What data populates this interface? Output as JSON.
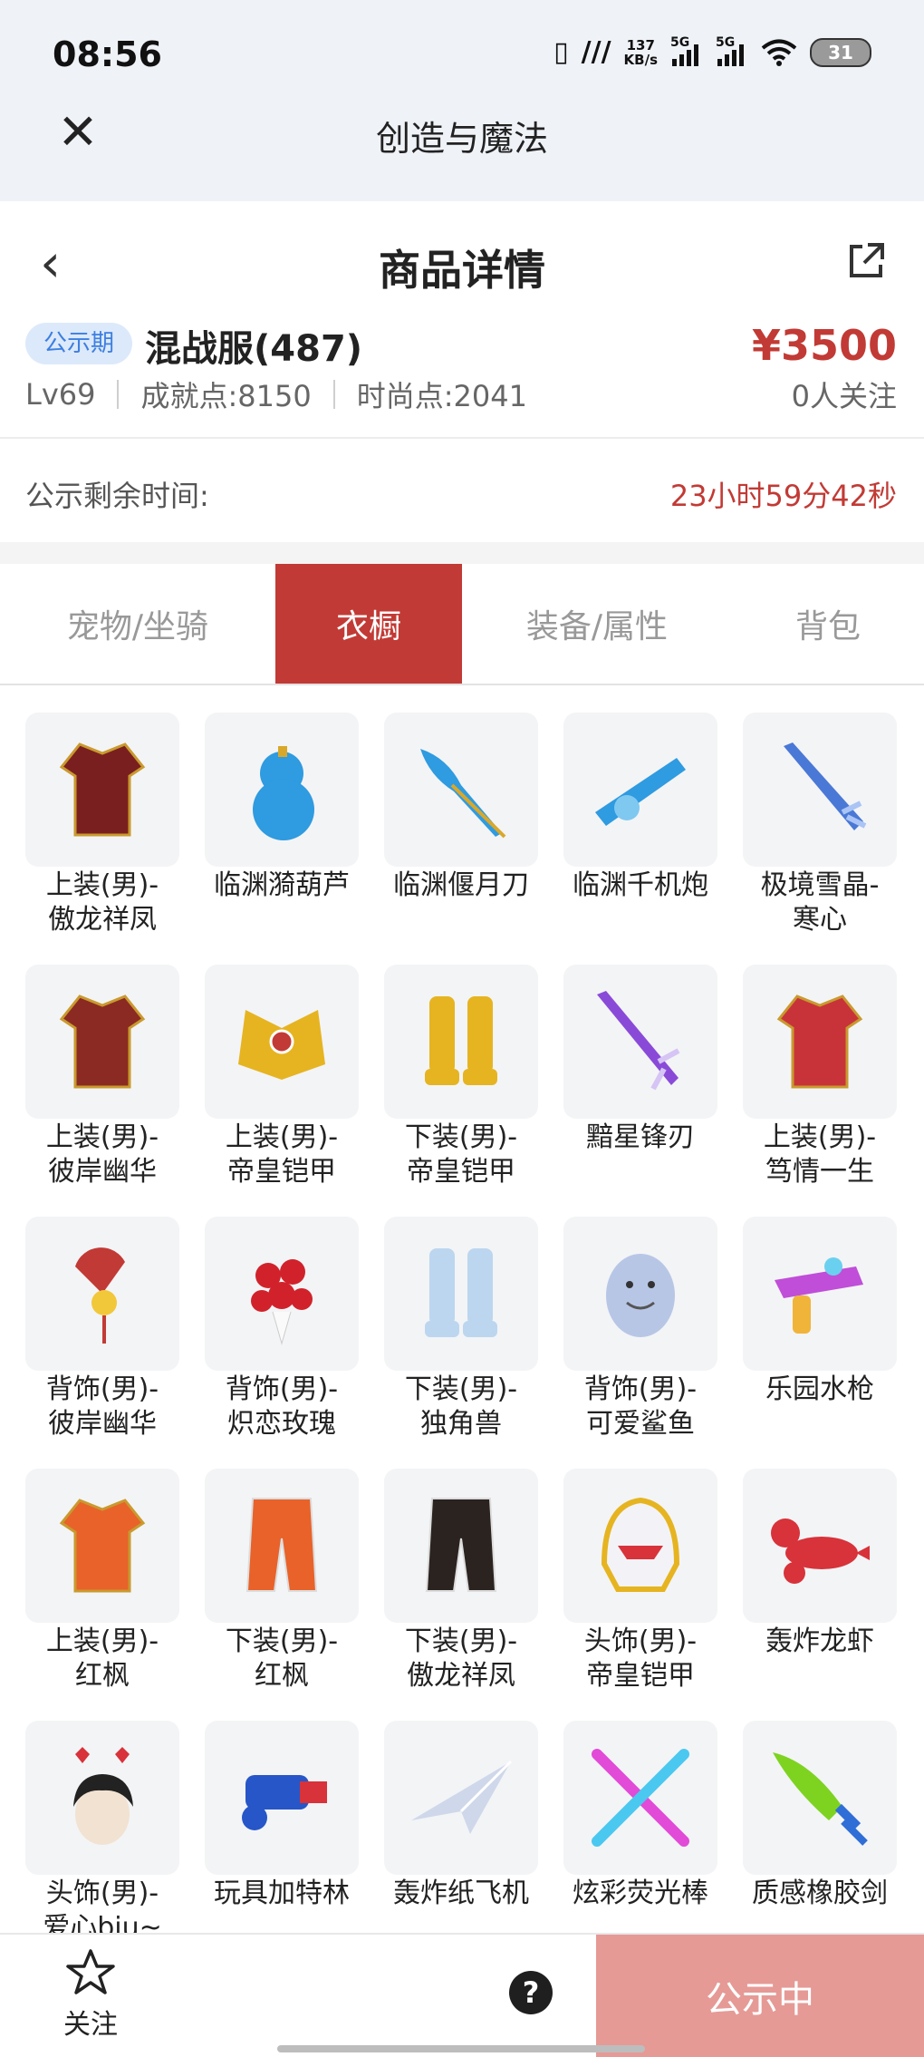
{
  "status_bar": {
    "time": "08:56",
    "net_speed_value": "137",
    "net_speed_unit": "KB/s",
    "sim1": "5G",
    "sim2": "5G",
    "battery": "31"
  },
  "webview": {
    "title": "创造与魔法"
  },
  "header": {
    "title": "商品详情"
  },
  "product": {
    "badge": "公示期",
    "name": "混战服(487)",
    "price": "¥3500",
    "level": "Lv69",
    "achievement": "成就点:8150",
    "fashion": "时尚点:2041",
    "followers": "0人关注"
  },
  "countdown": {
    "label": "公示剩余时间:",
    "value": "23小时59分42秒"
  },
  "tabs": [
    {
      "label": "宠物/坐骑",
      "active": false
    },
    {
      "label": "衣橱",
      "active": true
    },
    {
      "label": "装备/属性",
      "active": false
    },
    {
      "label": "背包",
      "active": false
    }
  ],
  "items": [
    {
      "line1": "上装(男)-",
      "line2": "傲龙祥凤",
      "icon": "outfit-icon",
      "color": "#7a1f1f"
    },
    {
      "line1": "临渊漪葫芦",
      "line2": "",
      "icon": "gourd-icon",
      "color": "#2f9be0"
    },
    {
      "line1": "临渊偃月刀",
      "line2": "",
      "icon": "glaive-icon",
      "color": "#2f9be0"
    },
    {
      "line1": "临渊千机炮",
      "line2": "",
      "icon": "cannon-icon",
      "color": "#2f9be0"
    },
    {
      "line1": "极境雪晶-",
      "line2": "寒心",
      "icon": "ice-sword-icon",
      "color": "#4a78d6"
    },
    {
      "line1": "上装(男)-",
      "line2": "彼岸幽华",
      "icon": "outfit-icon",
      "color": "#8b2a22"
    },
    {
      "line1": "上装(男)-",
      "line2": "帝皇铠甲",
      "icon": "armor-icon",
      "color": "#e6b421"
    },
    {
      "line1": "下装(男)-",
      "line2": "帝皇铠甲",
      "icon": "boots-icon",
      "color": "#e6b421"
    },
    {
      "line1": "黯星锋刃",
      "line2": "",
      "icon": "sword-icon",
      "color": "#8a4ad8"
    },
    {
      "line1": "上装(男)-",
      "line2": "笃情一生",
      "icon": "outfit-icon",
      "color": "#c8333a"
    },
    {
      "line1": "背饰(男)-",
      "line2": "彼岸幽华",
      "icon": "fan-icon",
      "color": "#c23a35"
    },
    {
      "line1": "背饰(男)-",
      "line2": "炽恋玫瑰",
      "icon": "rose-icon",
      "color": "#d1222b"
    },
    {
      "line1": "下装(男)-",
      "line2": "独角兽",
      "icon": "boots-icon",
      "color": "#bcd6ef"
    },
    {
      "line1": "背饰(男)-",
      "line2": "可爱鲨鱼",
      "icon": "shark-icon",
      "color": "#b8c6e6"
    },
    {
      "line1": "乐园水枪",
      "line2": "",
      "icon": "water-gun-icon",
      "color": "#c04ed8"
    },
    {
      "line1": "上装(男)-",
      "line2": "红枫",
      "icon": "outfit-icon",
      "color": "#e8622a"
    },
    {
      "line1": "下装(男)-",
      "line2": "红枫",
      "icon": "pants-icon",
      "color": "#e8622a"
    },
    {
      "line1": "下装(男)-",
      "line2": "傲龙祥凤",
      "icon": "pants-icon",
      "color": "#2a2320"
    },
    {
      "line1": "头饰(男)-",
      "line2": "帝皇铠甲",
      "icon": "helmet-icon",
      "color": "#e6b421"
    },
    {
      "line1": "轰炸龙虾",
      "line2": "",
      "icon": "lobster-icon",
      "color": "#d8323a"
    },
    {
      "line1": "头饰(男)-",
      "line2": "爱心biu~",
      "icon": "headband-icon",
      "color": "#222222"
    },
    {
      "line1": "玩具加特林",
      "line2": "",
      "icon": "gatling-icon",
      "color": "#2656c8"
    },
    {
      "line1": "轰炸纸飞机",
      "line2": "",
      "icon": "paper-plane-icon",
      "color": "#cfd8ea"
    },
    {
      "line1": "炫彩荧光棒",
      "line2": "",
      "icon": "glowstick-icon",
      "color": "#e24ad8"
    },
    {
      "line1": "质感橡胶剑",
      "line2": "",
      "icon": "rubber-sword-icon",
      "color": "#7ed321"
    }
  ],
  "bottom_bar": {
    "follow_label": "关注",
    "help_glyph": "?",
    "action_label": "公示中"
  }
}
